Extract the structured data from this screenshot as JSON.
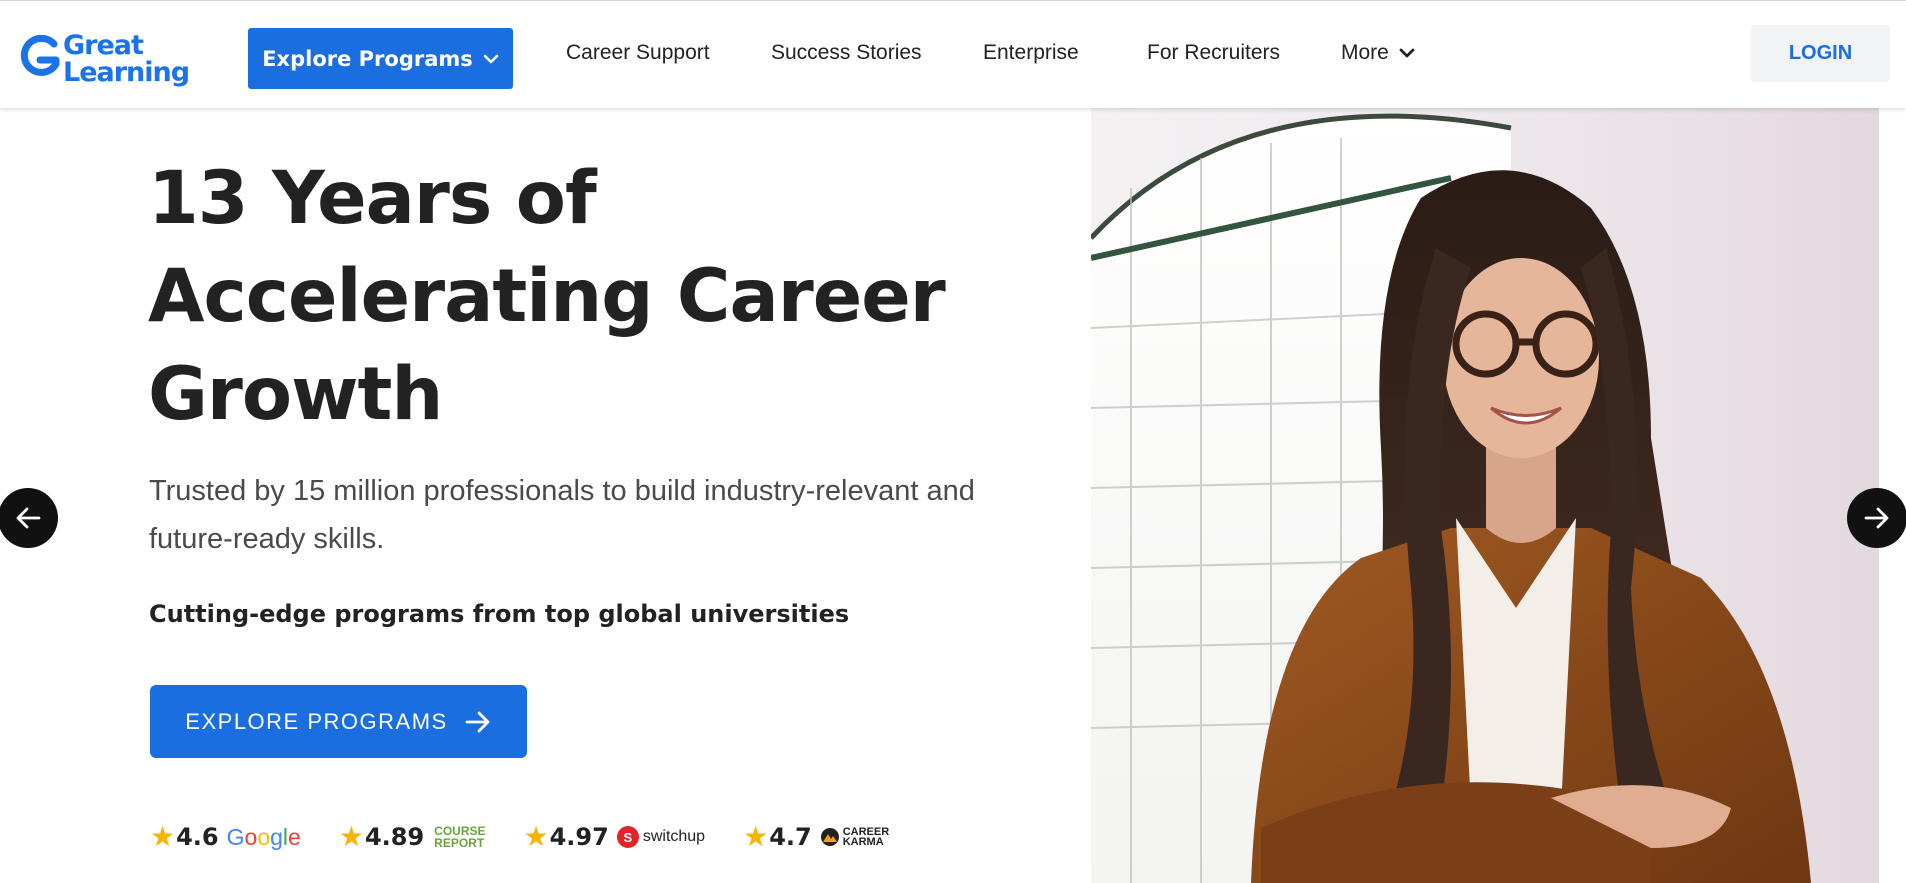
{
  "brand": {
    "logo_line1": "Great",
    "logo_line2": "Learning",
    "color": "#1a73e8"
  },
  "nav": {
    "explore_label": "Explore Programs",
    "items": [
      "Career Support",
      "Success Stories",
      "Enterprise",
      "For Recruiters"
    ],
    "more_label": "More",
    "login_label": "LOGIN"
  },
  "hero": {
    "title_lines": [
      "13 Years of",
      "Accelerating Career",
      "Growth"
    ],
    "subtitle": "Trusted by 15 million professionals to build industry-relevant and future-ready skills.",
    "tagline": "Cutting-edge programs from top global universities",
    "cta_label": "EXPLORE PROGRAMS",
    "image_alt_icon": "professional-woman-photo"
  },
  "ratings": [
    {
      "value": "4.6",
      "source": "Google"
    },
    {
      "value": "4.89",
      "source_line1": "COURSE",
      "source_line2": "REPORT"
    },
    {
      "value": "4.97",
      "source": "switchup"
    },
    {
      "value": "4.7",
      "source_line1": "CAREER",
      "source_line2": "KARMA"
    }
  ],
  "colors": {
    "primary": "#1a6ee0",
    "star": "#f6b400",
    "dark": "#222222"
  }
}
